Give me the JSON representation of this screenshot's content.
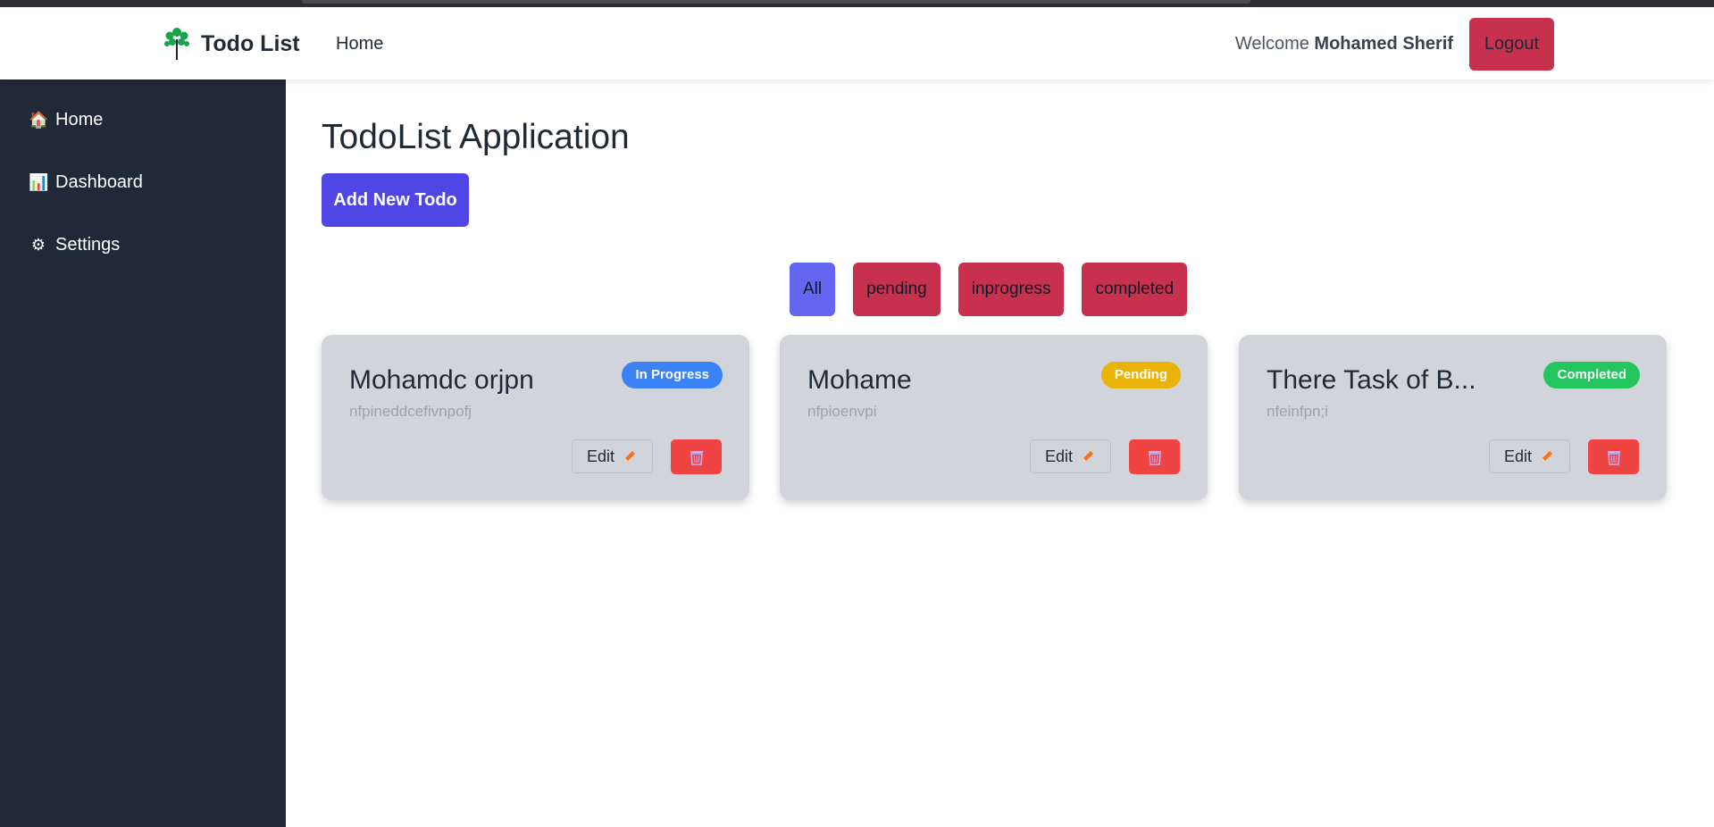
{
  "navbar": {
    "brand_name": "Todo List",
    "home_link": "Home",
    "welcome_prefix": "Welcome",
    "user_name": "Mohamed Sherif",
    "logout_label": "Logout"
  },
  "sidebar": {
    "items": [
      {
        "icon": "home-icon",
        "label": "Home"
      },
      {
        "icon": "chart-icon",
        "label": "Dashboard"
      },
      {
        "icon": "gear-icon",
        "label": "Settings"
      }
    ]
  },
  "main": {
    "title": "TodoList Application",
    "add_button": "Add New Todo",
    "filters": [
      "All",
      "pending",
      "inprogress",
      "completed"
    ],
    "active_filter": "All"
  },
  "todos": [
    {
      "title": "Mohamdc orjpn",
      "description": "nfpineddcefivnpofj",
      "status": "In Progress",
      "status_color": "#3b82f6",
      "edit_label": "Edit"
    },
    {
      "title": "Mohame",
      "description": "nfpioenvpi",
      "status": "Pending",
      "status_color": "#eab308",
      "edit_label": "Edit"
    },
    {
      "title": "There Task of B...",
      "description": "nfeinfpn;i",
      "status": "Completed",
      "status_color": "#22c55e",
      "edit_label": "Edit"
    }
  ],
  "colors": {
    "sidebar_bg": "#1f2937",
    "primary": "#4f46e5",
    "danger": "#c8314d",
    "active_filter": "#6366f1",
    "delete": "#ef4444"
  }
}
